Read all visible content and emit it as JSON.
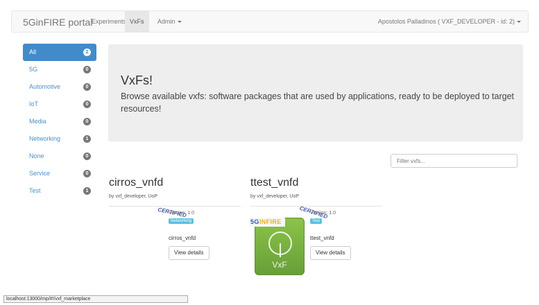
{
  "navbar": {
    "brand": "5GinFIRE portal",
    "items": [
      {
        "label": "Experiments"
      },
      {
        "label": "VxFs"
      },
      {
        "label": "Admin"
      }
    ],
    "user": "Apostolos Palladinos ( VXF_DEVELOPER - id: 2)"
  },
  "sidebar": {
    "items": [
      {
        "label": "All",
        "count": "2"
      },
      {
        "label": "5G",
        "count": "0"
      },
      {
        "label": "Automotive",
        "count": "0"
      },
      {
        "label": "IoT",
        "count": "0"
      },
      {
        "label": "Media",
        "count": "0"
      },
      {
        "label": "Networking",
        "count": "1"
      },
      {
        "label": "None",
        "count": "0"
      },
      {
        "label": "Service",
        "count": "0"
      },
      {
        "label": "Test",
        "count": "1"
      }
    ]
  },
  "jumbotron": {
    "title": "VxFs!",
    "text": "Browse available vxfs: software packages that are used by applications, ready to be deployed to target resources!"
  },
  "filter": {
    "placeholder": "Filter vxfs..."
  },
  "cards": [
    {
      "title": "cirros_vnfd",
      "by": "by vxf_developer, UoP",
      "certified": "CERTIFIED",
      "version": "Version: 1.0",
      "category": "Networking",
      "name": "cirros_vnfd",
      "button": "View details"
    },
    {
      "title": "ttest_vnfd",
      "by": "by vxf_developer, UoP",
      "certified": "CERTIFIED",
      "version": "Version: 1.0",
      "category": "Test",
      "name": "ttest_vnfd",
      "button": "View details",
      "logo_brand_a": "5G",
      "logo_brand_b": "INFIRE",
      "logo_text": "VxF"
    }
  ],
  "statusbar": "localhost:13000/mp/#!/vxf_marketplace",
  "colors": {
    "accent": "#428bca",
    "label": "#5bc0de",
    "logo_green": "#8bc34a",
    "badge": "#777777"
  }
}
